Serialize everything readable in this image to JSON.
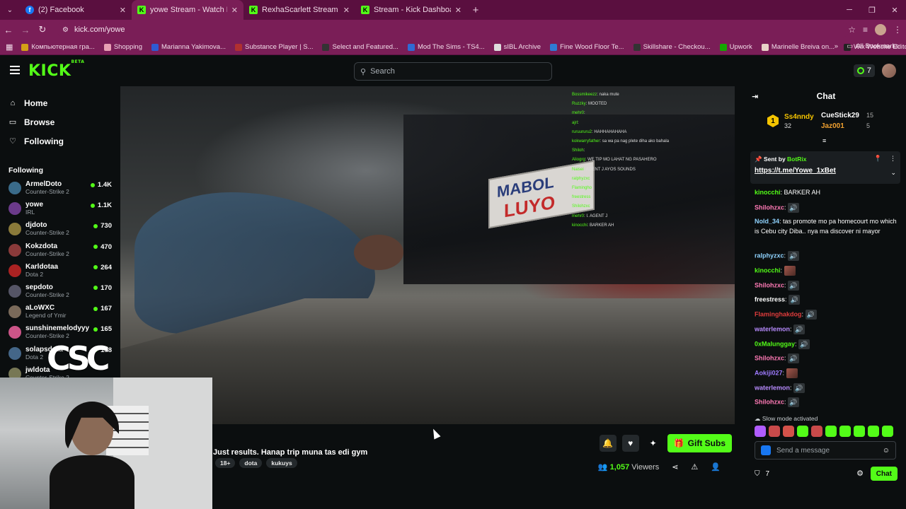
{
  "browser": {
    "tabs": [
      {
        "title": "(2) Facebook",
        "icon": "facebook-icon",
        "active": false
      },
      {
        "title": "yowe Stream - Watch Live o",
        "icon": "kick-icon",
        "active": true
      },
      {
        "title": "RexhaScarlett Stream - Watch L",
        "icon": "kick-icon",
        "active": false
      },
      {
        "title": "Stream - Kick Dashboard",
        "icon": "kick-icon",
        "active": false
      }
    ],
    "url": "kick.com/yowe",
    "bookmarks": [
      "Компьютерная гра...",
      "Shopping",
      "Marianna Yakimova...",
      "Substance Player | S...",
      "Select and Featured...",
      "Mod The Sims - TS4...",
      "sIBL Archive",
      "Fine Wood Floor Te...",
      "Skillshare - Checkou...",
      "Upwork",
      "Marinelle Breiva on...",
      "Wix Website Editor |..."
    ],
    "all_bookmarks": "All Bookmarks"
  },
  "header": {
    "logo": "KICK",
    "logo_badge": "BETA",
    "search_placeholder": "Search",
    "points": "7"
  },
  "sidebar": {
    "nav": [
      {
        "label": "Home",
        "icon": "home-icon"
      },
      {
        "label": "Browse",
        "icon": "browse-icon"
      },
      {
        "label": "Following",
        "icon": "heart-icon"
      }
    ],
    "following_title": "Following",
    "following": [
      {
        "name": "ArmelDoto",
        "category": "Counter-Strike 2",
        "viewers": "1.4K",
        "color": "#3a6b8a"
      },
      {
        "name": "yowe",
        "category": "IRL",
        "viewers": "1.1K",
        "color": "#6b3a8a"
      },
      {
        "name": "djdoto",
        "category": "Counter-Strike 2",
        "viewers": "730",
        "color": "#8a7a3a"
      },
      {
        "name": "Kokzdota",
        "category": "Counter-Strike 2",
        "viewers": "470",
        "color": "#8a3a3a"
      },
      {
        "name": "Karldotaa",
        "category": "Dota 2",
        "viewers": "264",
        "color": "#a22"
      },
      {
        "name": "sepdoto",
        "category": "Counter-Strike 2",
        "viewers": "170",
        "color": "#556"
      },
      {
        "name": "aLoWXC",
        "category": "Legend of Ymir",
        "viewers": "167",
        "color": "#7a6a5a"
      },
      {
        "name": "sunshinemelodyyy",
        "category": "Counter-Strike 2",
        "viewers": "165",
        "color": "#c58"
      },
      {
        "name": "solapsdota",
        "category": "Dota 2",
        "viewers": "158",
        "color": "#468"
      },
      {
        "name": "jwldota",
        "category": "Counter-Strike 2",
        "viewers": "",
        "color": "#775"
      }
    ]
  },
  "video": {
    "overlay_chat": [
      {
        "user": "Bossmikeezz",
        "text": ": naka mute"
      },
      {
        "user": "Ruzzky",
        "text": ": MOOTED"
      },
      {
        "user": "mehr0",
        "text": ":"
      },
      {
        "user": "ajrl",
        "text": ":"
      },
      {
        "user": "ruruururu2",
        "text": ": HAHHAHAHAHA"
      },
      {
        "user": "kokwarryfather",
        "text": ": sa wa pa nag plete diha ako bahala"
      },
      {
        "user": "Shiloh",
        "text": ":"
      },
      {
        "user": "Aliogrg",
        "text": ": WE TIP MO LAHAT NG PASAHERO"
      },
      {
        "user": "Naisei",
        "text": ": AGENT J AYOS SOUNDS"
      },
      {
        "user": "ralphyzxc",
        "text": ":"
      },
      {
        "user": "Flamingho",
        "text": ":"
      },
      {
        "user": "freestress",
        "text": ":"
      },
      {
        "user": "Shilohzxc",
        "text": ":"
      },
      {
        "user": "mehr0",
        "text": ": I. AGENT J"
      },
      {
        "user": "kinocchi",
        "text": ": BARKER AH"
      }
    ],
    "billboard_line1": "MABOL",
    "billboard_line2": "LUYO",
    "watermark": "CSC"
  },
  "stream": {
    "title": "Just results. Hanap trip muna tas edi gym",
    "tags": [
      "18+",
      "dota",
      "kukuys"
    ],
    "gift_label": "Gift Subs",
    "viewers": "1,057",
    "viewers_label": "Viewers"
  },
  "chat": {
    "title": "Chat",
    "leaderboard": [
      {
        "name": "Ss4nndy",
        "score": "32",
        "rank": "1"
      },
      {
        "name": "CueStick29",
        "score": "15"
      },
      {
        "name": "Jaz001",
        "score": "5"
      }
    ],
    "pinned": {
      "sent_by": "Sent by",
      "bot": "BotRix",
      "link": "https://t.me/Yowe_1xBet"
    },
    "messages": [
      {
        "user": "kinocchi",
        "text": "BARKER AH",
        "color": "#53fc18",
        "emote": ""
      },
      {
        "user": "Shilohzxc",
        "text": "",
        "color": "#ff7ab6",
        "emote": "🔊"
      },
      {
        "user": "Nold_34",
        "text": "tas promote mo pa homecourt mo which is Cebu city Diba.. nya ma discover ni mayor",
        "color": "#8fd3ff",
        "emote": ""
      },
      {
        "user": "ralphyzxc",
        "text": "",
        "color": "#8fd3ff",
        "emote": "🔊"
      },
      {
        "user": "kinocchi",
        "text": "",
        "color": "#53fc18",
        "emote": "img"
      },
      {
        "user": "Shilohzxc",
        "text": "",
        "color": "#ff7ab6",
        "emote": "🔊"
      },
      {
        "user": "freestress",
        "text": "",
        "color": "#ffffff",
        "emote": "🔊"
      },
      {
        "user": "Flaminghakdog",
        "text": "",
        "color": "#e03c3c",
        "emote": "🔊"
      },
      {
        "user": "waterlemon",
        "text": "",
        "color": "#b88cff",
        "emote": "🔊"
      },
      {
        "user": "0xMalunggay",
        "text": "",
        "color": "#53fc18",
        "emote": "🔊"
      },
      {
        "user": "Shilohzxc",
        "text": "",
        "color": "#ff7ab6",
        "emote": "🔊"
      },
      {
        "user": "Aokiji027",
        "text": "",
        "color": "#9e7bff",
        "emote": "img"
      },
      {
        "user": "waterlemon",
        "text": "",
        "color": "#b88cff",
        "emote": "🔊"
      },
      {
        "user": "Shilohzxc",
        "text": "",
        "color": "#ff7ab6",
        "emote": "🔊"
      }
    ],
    "slow_mode": "Slow mode activated",
    "send_placeholder": "Send a message",
    "points": "7",
    "chat_button": "Chat"
  },
  "colors": {
    "accent": "#53fc18",
    "background": "#0b0e0f",
    "browser": "#7a1e57"
  }
}
